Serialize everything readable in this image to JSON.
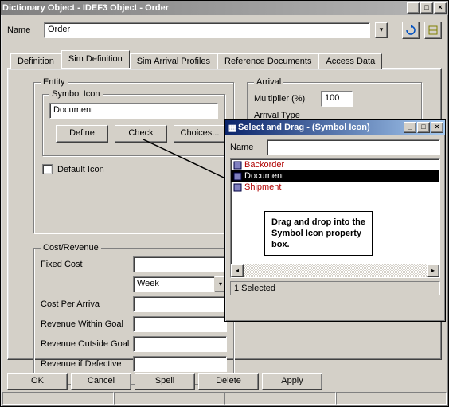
{
  "main_window": {
    "title": "Dictionary Object - IDEF3 Object - Order",
    "name_label": "Name",
    "name_value": "Order"
  },
  "tabs": {
    "definition": "Definition",
    "sim_definition": "Sim Definition",
    "sim_arrival": "Sim Arrival Profiles",
    "ref_docs": "Reference Documents",
    "access_data": "Access Data"
  },
  "entity": {
    "legend": "Entity",
    "symbol_icon_legend": "Symbol Icon",
    "symbol_icon_value": "Document",
    "define_btn": "Define",
    "check_btn": "Check",
    "choices_btn": "Choices...",
    "default_icon_label": "Default Icon"
  },
  "arrival": {
    "legend": "Arrival",
    "multiplier_label": "Multiplier (%)",
    "multiplier_value": "100",
    "arrival_type_label": "Arrival Type"
  },
  "costrev": {
    "legend": "Cost/Revenue",
    "fixed_cost": "Fixed Cost",
    "period_value": "Week",
    "cost_per_arriva": "Cost Per Arriva",
    "rev_within": "Revenue Within Goal",
    "rev_outside": "Revenue Outside Goal",
    "rev_defective": "Revenue if Defective"
  },
  "footer": {
    "ok": "OK",
    "cancel": "Cancel",
    "spell": "Spell",
    "delete": "Delete",
    "apply": "Apply"
  },
  "popup": {
    "title": "Select and Drag - (Symbol Icon)",
    "name_label": "Name",
    "items": {
      "backorder": "Backorder",
      "document": "Document",
      "shipment": "Shipment"
    },
    "status": "1 Selected"
  },
  "tooltip": "Drag and drop into the Symbol Icon property box."
}
